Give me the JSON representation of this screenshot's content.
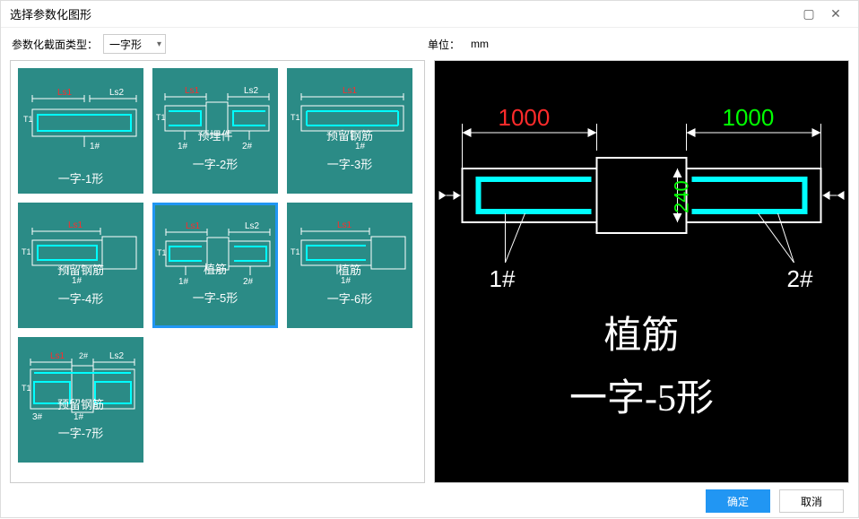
{
  "window": {
    "title": "选择参数化图形"
  },
  "toolbar": {
    "section_type_label": "参数化截面类型：",
    "section_type_value": "一字形",
    "unit_label": "单位：",
    "unit_value": "mm"
  },
  "thumbs": [
    {
      "line1": "",
      "line2": "一字-1形",
      "selected": false
    },
    {
      "line1": "预埋件",
      "line2": "一字-2形",
      "selected": false
    },
    {
      "line1": "预留钢筋",
      "line2": "一字-3形",
      "selected": false
    },
    {
      "line1": "预留钢筋",
      "line2": "一字-4形",
      "selected": false
    },
    {
      "line1": "植筋",
      "line2": "一字-5形",
      "selected": true
    },
    {
      "line1": "植筋",
      "line2": "一字-6形",
      "selected": false
    },
    {
      "line1": "预留钢筋",
      "line2": "一字-7形",
      "selected": false
    }
  ],
  "preview": {
    "left_dim": "1000",
    "right_dim": "1000",
    "vert_dim": "240",
    "left_tag": "1#",
    "right_tag": "2#",
    "caption_line1": "植筋",
    "caption_line2": "一字-5形"
  },
  "buttons": {
    "ok": "确定",
    "cancel": "取消"
  },
  "thumb_labels": {
    "ls1": "Ls1",
    "ls2": "Ls2",
    "t1": "T1",
    "h1": "1#",
    "h2": "2#",
    "h3": "3#"
  }
}
